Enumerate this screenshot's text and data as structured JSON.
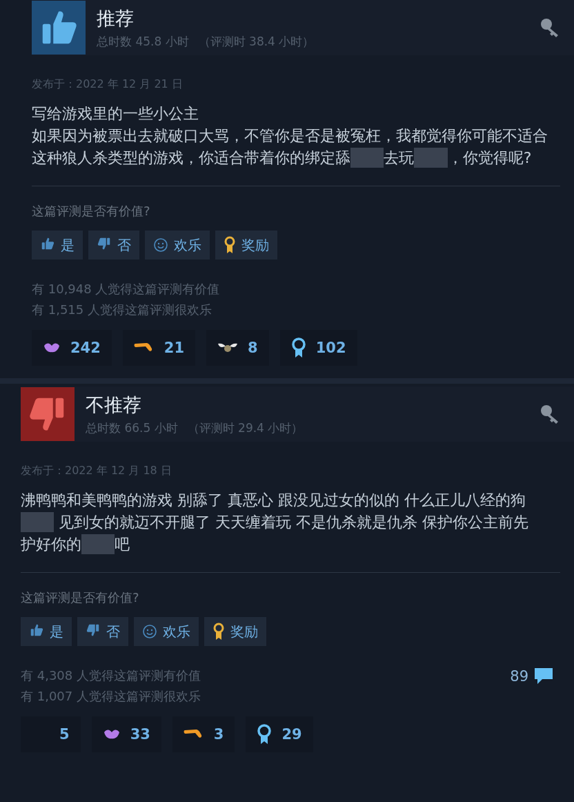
{
  "reviews": [
    {
      "verdict": "推荐",
      "kind": "up",
      "hours": "总时数 45.8 小时",
      "review_hours": "（评测时 38.4 小时）",
      "posted": "发布于：2022 年 12 月 21 日",
      "body": [
        [
          {
            "kind": "text",
            "text": "写给游戏里的一些小公主"
          }
        ],
        [
          {
            "kind": "text",
            "text": "如果因为被票出去就破口大骂，不管你是否是被冤枉，我都觉得你可能不适合这种狼人杀类型的游戏，你适合带着你的绑定舔"
          },
          {
            "kind": "redacted"
          },
          {
            "kind": "text",
            "text": "去玩"
          },
          {
            "kind": "redacted"
          },
          {
            "kind": "text",
            "text": "，你觉得呢?"
          }
        ]
      ],
      "question": "这篇评测是否有价值?",
      "votes": [
        {
          "kind": "yes",
          "label": "是"
        },
        {
          "kind": "no",
          "label": "否"
        },
        {
          "kind": "funny",
          "label": "欢乐"
        },
        {
          "kind": "award",
          "label": "奖励"
        }
      ],
      "stats": [
        "有 10,948 人觉得这篇评测有价值",
        "有 1,515 人觉得这篇评测很欢乐"
      ],
      "awards": [
        {
          "kind": "lips",
          "count": "242"
        },
        {
          "kind": "boomerang",
          "count": "21"
        },
        {
          "kind": "wings",
          "count": "8"
        },
        {
          "kind": "medal",
          "count": "102"
        }
      ]
    },
    {
      "verdict": "不推荐",
      "kind": "down",
      "hours": "总时数 66.5 小时",
      "review_hours": "（评测时 29.4 小时）",
      "posted": "发布于：2022 年 12 月 18 日",
      "body": [
        [
          {
            "kind": "text",
            "text": "沸鸭鸭和美鸭鸭的游戏 别舔了 真恶心 跟没见过女的似的 什么正儿八经的狗"
          },
          {
            "kind": "redacted"
          },
          {
            "kind": "text",
            "text": " 见到女的就迈不开腿了 天天缠着玩 不是仇杀就是仇杀 保护你公主前先护好你的"
          },
          {
            "kind": "redacted"
          },
          {
            "kind": "text",
            "text": "吧"
          }
        ]
      ],
      "question": "这篇评测是否有价值?",
      "votes": [
        {
          "kind": "yes",
          "label": "是"
        },
        {
          "kind": "no",
          "label": "否"
        },
        {
          "kind": "funny",
          "label": "欢乐"
        },
        {
          "kind": "award",
          "label": "奖励"
        }
      ],
      "stats": [
        "有 4,308 人觉得这篇评测有价值",
        "有 1,007 人觉得这篇评测很欢乐"
      ],
      "comments": "89",
      "awards": [
        {
          "kind": "blank",
          "count": "5"
        },
        {
          "kind": "lips",
          "count": "33"
        },
        {
          "kind": "boomerang",
          "count": "3"
        },
        {
          "kind": "medal",
          "count": "29"
        }
      ]
    }
  ]
}
